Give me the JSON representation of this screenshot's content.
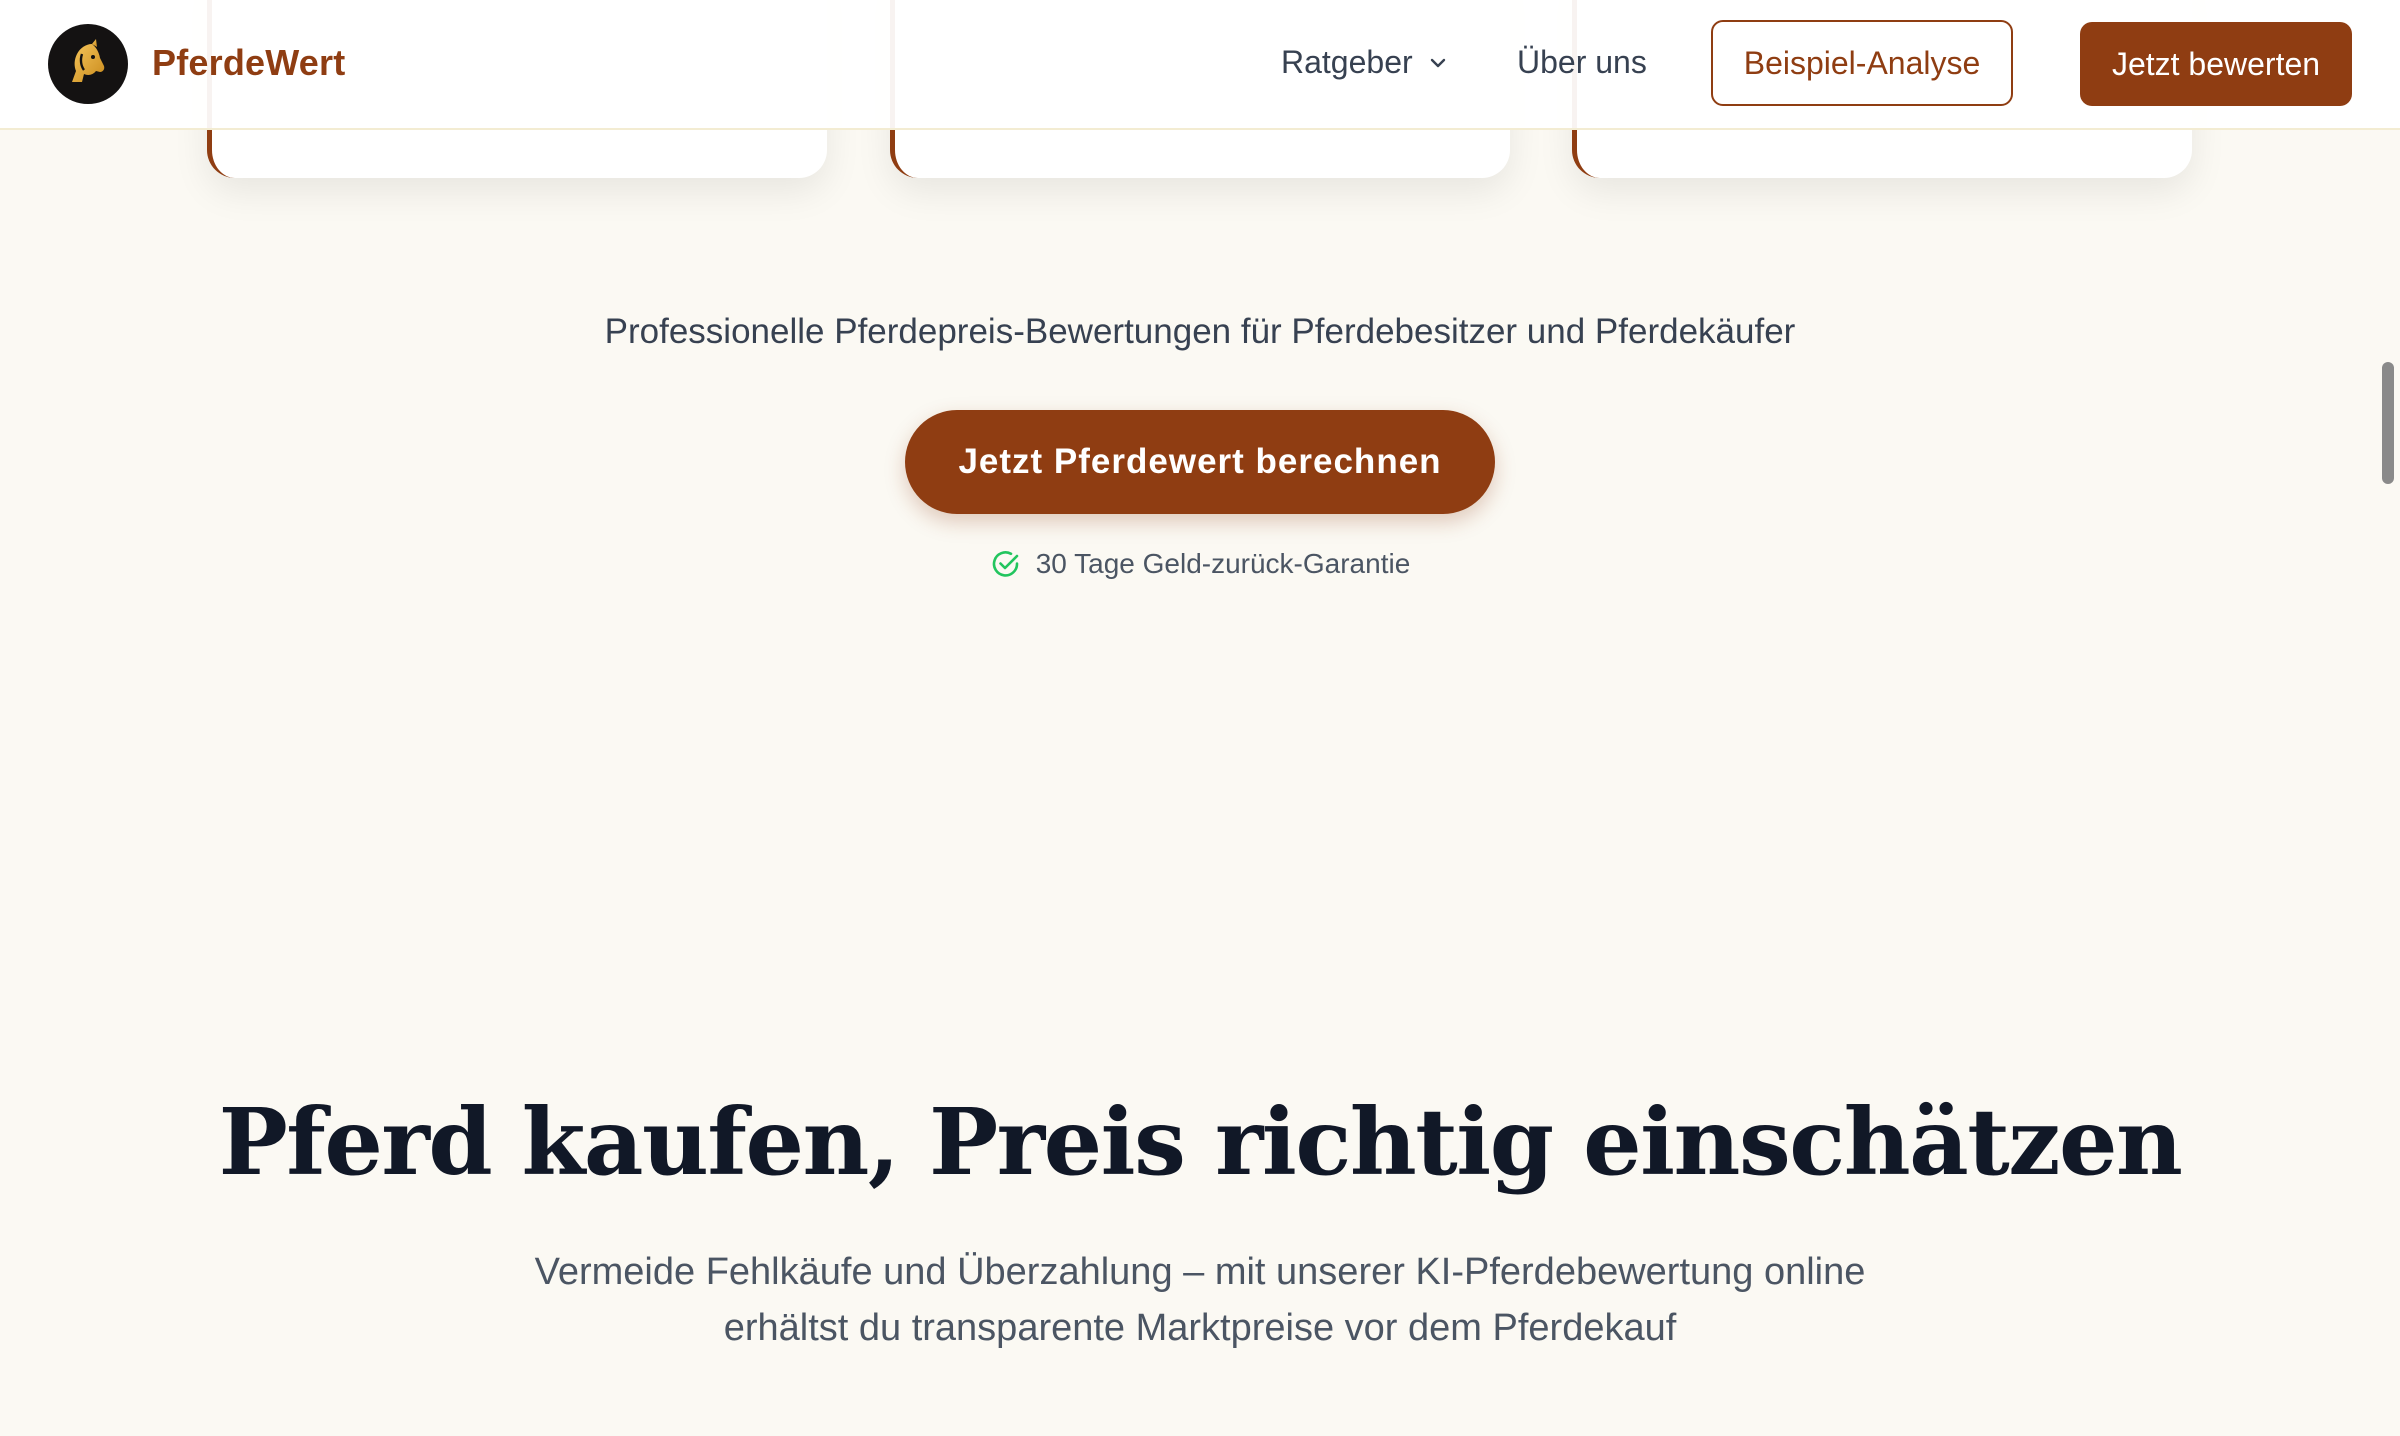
{
  "header": {
    "brand": "PferdeWert",
    "nav": {
      "ratgeber": "Ratgeber",
      "ueber_uns": "Über uns"
    },
    "example_button": "Beispiel-Analyse",
    "evaluate_button": "Jetzt bewerten"
  },
  "hero": {
    "tagline": "Professionelle Pferdepreis-Bewertungen für Pferdebesitzer und Pferdekäufer",
    "cta_label": "Jetzt Pferdewert berechnen",
    "guarantee": "30 Tage Geld-zurück-Garantie"
  },
  "section": {
    "title": "Pferd kaufen, Preis richtig einschätzen",
    "subtitle_line1": "Vermeide Fehlkäufe und Überzahlung – mit unserer KI-Pferdebewertung online",
    "subtitle_line2": "erhältst du transparente Marktpreise vor dem Pferdekauf"
  },
  "colors": {
    "brand": "#8f3d12",
    "background": "#fbf9f3",
    "success": "#22c55e"
  },
  "icons": {
    "logo": "horse-head-icon",
    "dropdown": "chevron-down-icon",
    "guarantee": "check-circle-icon"
  }
}
